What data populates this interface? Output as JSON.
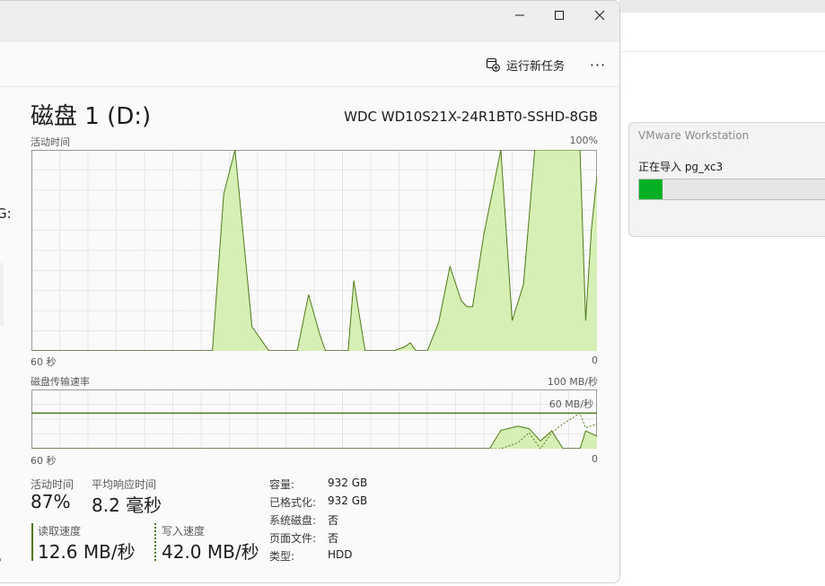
{
  "vmware_dialog": {
    "title": "VMware Workstation",
    "status": "正在导入 pg_xc3",
    "progress_fraction": 0.12
  },
  "toolbar": {
    "new_task_label": "运行新任务",
    "more_label": "···"
  },
  "sidebar_fragments": {
    "cut_text": "G:",
    "bottom_text": "P"
  },
  "disk": {
    "title": "磁盘 1 (D:)",
    "model": "WDC WD10S21X-24R1BT0-SSHD-8GB"
  },
  "active_chart": {
    "label": "活动时间",
    "max_label": "100%",
    "time_label": "60 秒",
    "min_label": "0"
  },
  "transfer_chart": {
    "label": "磁盘传输速率",
    "max_label": "100 MB/秒",
    "ref_label": "60 MB/秒",
    "time_label": "60 秒",
    "min_label": "0"
  },
  "stats": {
    "active_time_label": "活动时间",
    "active_time_value": "87%",
    "avg_response_label": "平均响应时间",
    "avg_response_value": "8.2 毫秒",
    "read_speed_label": "读取速度",
    "read_speed_value": "12.6 MB/秒",
    "write_speed_label": "写入速度",
    "write_speed_value": "42.0 MB/秒"
  },
  "properties": [
    {
      "key": "容量:",
      "value": "932 GB"
    },
    {
      "key": "已格式化:",
      "value": "932 GB"
    },
    {
      "key": "系统磁盘:",
      "value": "否"
    },
    {
      "key": "页面文件:",
      "value": "否"
    },
    {
      "key": "类型:",
      "value": "HDD"
    }
  ],
  "colors": {
    "fill": "#d6efb4",
    "line": "#4f7a1a",
    "grid": "#e6e6e6",
    "progress": "#06b025"
  },
  "chart_data": [
    {
      "type": "area",
      "ylabel": "活动时间",
      "ylim": [
        0,
        100
      ],
      "x_unit": "seconds ago",
      "x": [
        60,
        40.8,
        39.6,
        38.4,
        36.6,
        34.8,
        33,
        32.4,
        31.8,
        30.6,
        29.4,
        28.8,
        28.2,
        27,
        26.4,
        25.8,
        24.6,
        24,
        23.4,
        22.8,
        21.6,
        20.4,
        19.8,
        19.2,
        18,
        16.8,
        15.6,
        14.4,
        13.8,
        13.2,
        12,
        10.2,
        9,
        7.8,
        6.6,
        5.4,
        4.8,
        4.2,
        1.8,
        1.2,
        0.6,
        0
      ],
      "y": [
        0,
        0,
        78,
        100,
        12,
        0,
        0,
        0,
        0,
        28,
        8,
        0,
        0,
        0,
        0,
        35,
        0,
        0,
        0,
        0,
        0,
        2,
        4,
        0,
        0,
        14,
        42,
        25,
        22,
        22,
        58,
        100,
        15,
        33,
        100,
        100,
        100,
        100,
        100,
        15,
        60,
        87
      ]
    },
    {
      "type": "area",
      "ylabel": "磁盘传输速率",
      "ylim": [
        0,
        100
      ],
      "y_unit": "MB/秒",
      "x_unit": "seconds ago",
      "x": [
        60,
        11.4,
        10.2,
        8.4,
        7.2,
        6,
        4.8,
        3.6,
        1.8,
        1.2,
        0
      ],
      "read": [
        0,
        0,
        31,
        38,
        34,
        13,
        30,
        0,
        0,
        30,
        21
      ],
      "write": [
        0,
        0,
        0,
        10,
        27,
        0,
        27,
        42,
        60,
        35,
        42
      ],
      "reference_line": 60
    }
  ]
}
